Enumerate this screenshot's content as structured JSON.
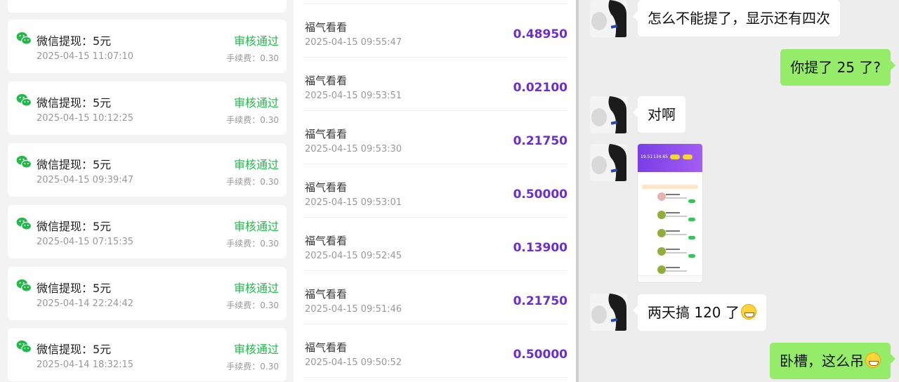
{
  "withdrawals": {
    "icon": "wechat-icon",
    "icon_color": "#22b84a",
    "items": [
      {
        "title": "微信提现：5元",
        "time": "2025-04-15 11:07:10",
        "status": "审核通过",
        "fee": "手续费：0.30"
      },
      {
        "title": "微信提现：5元",
        "time": "2025-04-15 10:12:25",
        "status": "审核通过",
        "fee": "手续费：0.30"
      },
      {
        "title": "微信提现：5元",
        "time": "2025-04-15 09:39:47",
        "status": "审核通过",
        "fee": "手续费：0.30"
      },
      {
        "title": "微信提现：5元",
        "time": "2025-04-15 07:15:35",
        "status": "审核通过",
        "fee": "手续费：0.30"
      },
      {
        "title": "微信提现：5元",
        "time": "2025-04-14 22:24:42",
        "status": "审核通过",
        "fee": "手续费：0.30"
      },
      {
        "title": "微信提现：5元",
        "time": "2025-04-14 18:32:15",
        "status": "审核通过",
        "fee": "手续费：0.30"
      }
    ]
  },
  "earnings": {
    "amount_color": "#6b2fc9",
    "items": [
      {
        "name": "福气看看",
        "time": "2025-04-15 09:55:47",
        "amount": "0.48950"
      },
      {
        "name": "福气看看",
        "time": "2025-04-15 09:53:51",
        "amount": "0.02100"
      },
      {
        "name": "福气看看",
        "time": "2025-04-15 09:53:30",
        "amount": "0.21750"
      },
      {
        "name": "福气看看",
        "time": "2025-04-15 09:53:01",
        "amount": "0.50000"
      },
      {
        "name": "福气看看",
        "time": "2025-04-15 09:52:45",
        "amount": "0.13900"
      },
      {
        "name": "福气看看",
        "time": "2025-04-15 09:51:46",
        "amount": "0.21750"
      },
      {
        "name": "福气看看",
        "time": "2025-04-15 09:50:52",
        "amount": "0.50000"
      }
    ]
  },
  "chat": {
    "incoming_bubble_color": "#ffffff",
    "outgoing_bubble_color": "#95ec69",
    "messages": [
      {
        "from": "other",
        "text": "怎么不能提了，显示还有四次"
      },
      {
        "from": "me",
        "text": "你提了 25 了?"
      },
      {
        "from": "other",
        "text": "对啊"
      },
      {
        "from": "other",
        "type": "image",
        "image": {
          "stat1": "19.51",
          "stat2": "134.65"
        }
      },
      {
        "from": "other",
        "text": "两天搞 120 了",
        "emoji": "grinning-face-emoji"
      },
      {
        "from": "me",
        "text": "卧槽，这么吊",
        "emoji": "thinking-face-emoji"
      }
    ]
  }
}
